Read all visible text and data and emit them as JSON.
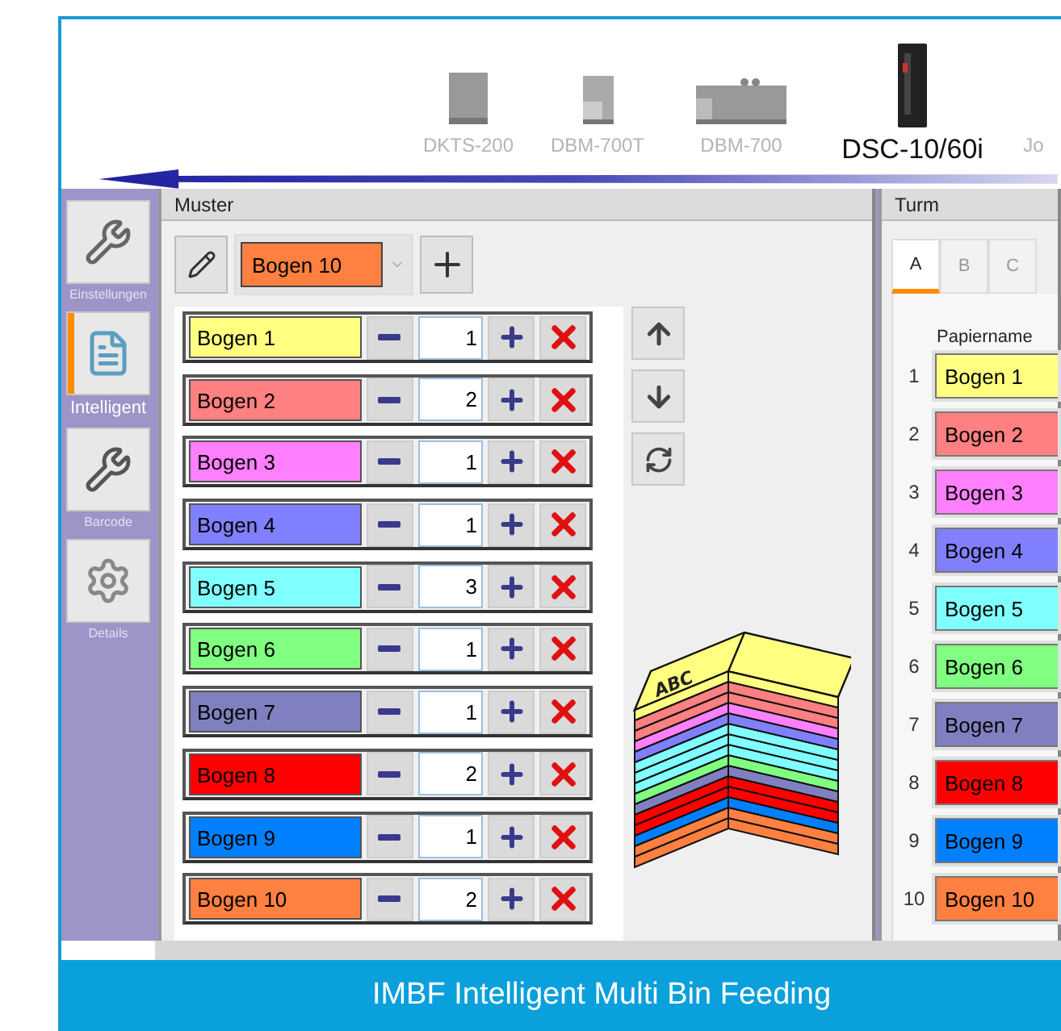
{
  "devices": [
    {
      "label": "DKTS-200",
      "kind": "stacker",
      "selected": false
    },
    {
      "label": "DBM-700T",
      "kind": "module",
      "selected": false
    },
    {
      "label": "DBM-700",
      "kind": "bookletmaker",
      "selected": false
    },
    {
      "label": "DSC-10/60i",
      "kind": "tower",
      "selected": true
    },
    {
      "label": "Jo",
      "selected": false
    }
  ],
  "sidebar": [
    {
      "label": "Einstellungen",
      "kind": "settings",
      "selected": false
    },
    {
      "label": "Intelligent",
      "kind": "intelligent",
      "selected": true
    },
    {
      "label": "Barcode",
      "kind": "barcode",
      "selected": false
    },
    {
      "label": "Details",
      "kind": "details",
      "selected": false
    }
  ],
  "muster": {
    "title": "Muster",
    "selector": {
      "value": "Bogen 10",
      "color": "#ff8040"
    },
    "patterns": [
      {
        "name": "Bogen 1",
        "color": "#ffff80",
        "count": "1"
      },
      {
        "name": "Bogen 2",
        "color": "#ff8080",
        "count": "2"
      },
      {
        "name": "Bogen 3",
        "color": "#ff80ff",
        "count": "1"
      },
      {
        "name": "Bogen 4",
        "color": "#8080ff",
        "count": "1"
      },
      {
        "name": "Bogen 5",
        "color": "#80ffff",
        "count": "3"
      },
      {
        "name": "Bogen 6",
        "color": "#80ff80",
        "count": "1"
      },
      {
        "name": "Bogen 7",
        "color": "#8080c0",
        "count": "1"
      },
      {
        "name": "Bogen 8",
        "color": "#ff0000",
        "count": "2"
      },
      {
        "name": "Bogen 9",
        "color": "#0080ff",
        "count": "1"
      },
      {
        "name": "Bogen 10",
        "color": "#ff8040",
        "count": "2"
      }
    ],
    "stack_label": "ABC"
  },
  "turm": {
    "title": "Turm",
    "tabs": [
      {
        "label": "A",
        "selected": true
      },
      {
        "label": "B",
        "selected": false
      },
      {
        "label": "C",
        "selected": false
      }
    ],
    "column_header": "Papiername",
    "bins": [
      {
        "number": "1",
        "name": "Bogen 1",
        "color": "#ffff80"
      },
      {
        "number": "2",
        "name": "Bogen 2",
        "color": "#ff8080"
      },
      {
        "number": "3",
        "name": "Bogen 3",
        "color": "#ff80ff"
      },
      {
        "number": "4",
        "name": "Bogen 4",
        "color": "#8080ff"
      },
      {
        "number": "5",
        "name": "Bogen 5",
        "color": "#80ffff"
      },
      {
        "number": "6",
        "name": "Bogen 6",
        "color": "#80ff80"
      },
      {
        "number": "7",
        "name": "Bogen 7",
        "color": "#8080c0"
      },
      {
        "number": "8",
        "name": "Bogen 8",
        "color": "#ff0000"
      },
      {
        "number": "9",
        "name": "Bogen 9",
        "color": "#0080ff"
      },
      {
        "number": "10",
        "name": "Bogen 10",
        "color": "#ff8040"
      }
    ]
  },
  "caption": "IMBF Intelligent Multi Bin Feeding"
}
